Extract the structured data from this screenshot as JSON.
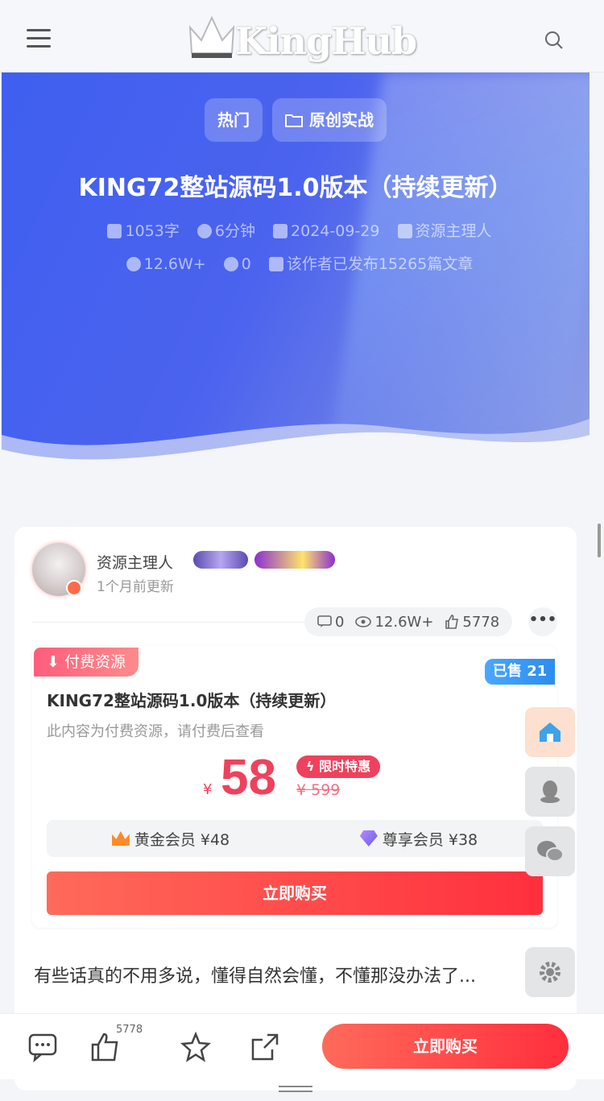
{
  "header": {
    "logo_text": "KingHub",
    "menu_icon": "hamburger-menu-icon",
    "search_icon": "search-icon"
  },
  "hero": {
    "tags": [
      {
        "label": "热门",
        "icon": ""
      },
      {
        "label": "原创实战",
        "icon": "folder-icon"
      }
    ],
    "title": "KING72整站源码1.0版本（持续更新）",
    "meta": {
      "words": "1053字",
      "read_time": "6分钟",
      "date": "2024-09-29",
      "author": "资源主理人",
      "views": "12.6W+",
      "comments": "0",
      "published": "该作者已发布15265篇文章"
    },
    "colors": {
      "start": "#3f5ff0",
      "end": "#8fa0e6"
    }
  },
  "author": {
    "name": "资源主理人",
    "updated": "1个月前更新"
  },
  "stats": {
    "comments": "0",
    "views": "12.6W+",
    "likes": "5778"
  },
  "pay": {
    "tag": "付费资源",
    "sold": "已售 21",
    "title": "KING72整站源码1.0版本（持续更新）",
    "desc": "此内容为付费资源，请付费后查看",
    "currency": "¥",
    "price": "58",
    "limited_label": "限时特惠",
    "original_price": "¥ 599",
    "members": [
      {
        "label": "黄金会员 ¥48",
        "icon": "crown-icon"
      },
      {
        "label": "尊享会员 ¥38",
        "icon": "diamond-icon"
      }
    ],
    "buy_label": "立即购买",
    "accent": "#f0415c"
  },
  "excerpt": "有些话真的不用多说，懂得自然会懂，不懂那没办法了...",
  "bottom": {
    "like_count": "5778",
    "buy_label": "立即购买"
  }
}
